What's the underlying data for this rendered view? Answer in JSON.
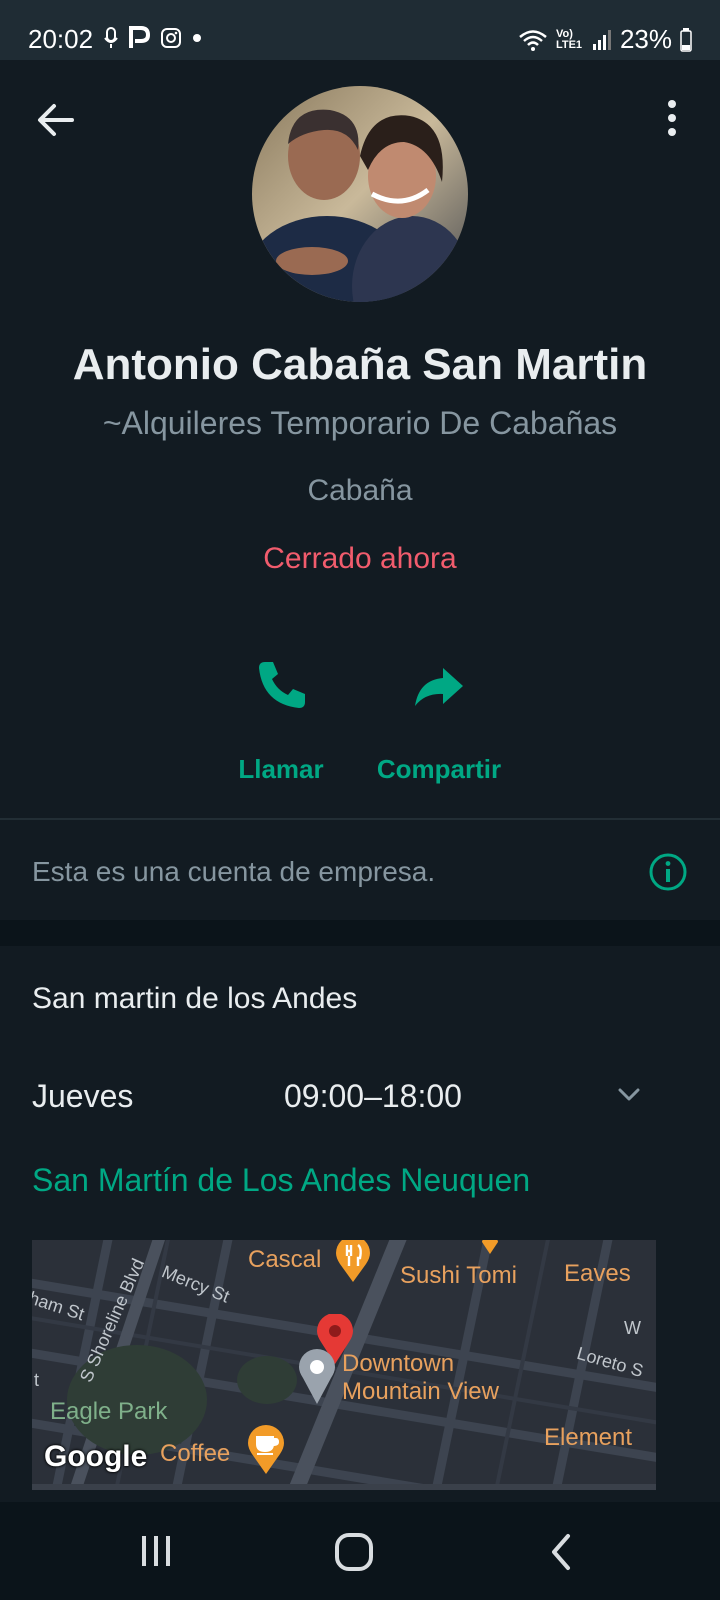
{
  "status_bar": {
    "time": "20:02",
    "battery": "23%",
    "network": "Vo) LTE1"
  },
  "profile": {
    "name": "Antonio Cabaña San Martin",
    "subtitle": "~Alquileres Temporario De Cabañas",
    "category": "Cabaña",
    "status": "Cerrado ahora"
  },
  "actions": {
    "call_label": "Llamar",
    "share_label": "Compartir"
  },
  "business_note": {
    "text": "Esta es una cuenta de empresa."
  },
  "details": {
    "location_title": "San martin de los Andes",
    "day": "Jueves",
    "hours": "09:00–18:00",
    "address": "San Martín de Los Andes Neuquen"
  },
  "map": {
    "labels": {
      "cascal": "Cascal",
      "sushi": "Sushi Tomi",
      "eaves": "Eaves",
      "downtown_line1": "Downtown",
      "downtown_line2": "Mountain View",
      "eagle_park": "Eagle Park",
      "coffee": "Coffee",
      "element": "Element",
      "mercy": "Mercy St",
      "shoreline": "S Shoreline Blvd",
      "ham": "ham St",
      "loreto": "Loreto S",
      "w": "W",
      "t": "t"
    },
    "logo": "Google"
  },
  "colors": {
    "accent": "#00a884",
    "closed": "#f15c6d",
    "background": "#121b22"
  }
}
